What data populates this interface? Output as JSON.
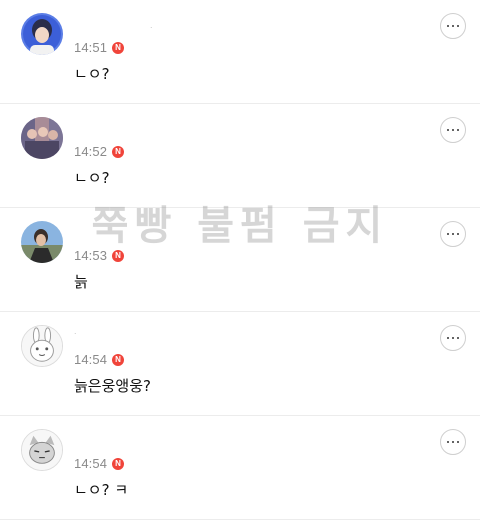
{
  "comments": [
    {
      "time": "14:51",
      "badge": "N",
      "text": "ㄴㅇ?",
      "name_mark": "."
    },
    {
      "time": "14:52",
      "badge": "N",
      "text": "ㄴㅇ?"
    },
    {
      "time": "14:53",
      "badge": "N",
      "text": "늙"
    },
    {
      "time": "14:54",
      "badge": "N",
      "text": "늙은웅앵웅?",
      "name_mark": "."
    },
    {
      "time": "14:54",
      "badge": "N",
      "text": "ㄴㅇ? ㅋ"
    }
  ],
  "watermark": "쭉빵 불펌 금지",
  "colors": {
    "badge": "#f0443a",
    "divider": "#ececec",
    "time": "#8a8a8a"
  },
  "icons": {
    "more": "more-options-icon",
    "badge": "new-badge-icon"
  }
}
